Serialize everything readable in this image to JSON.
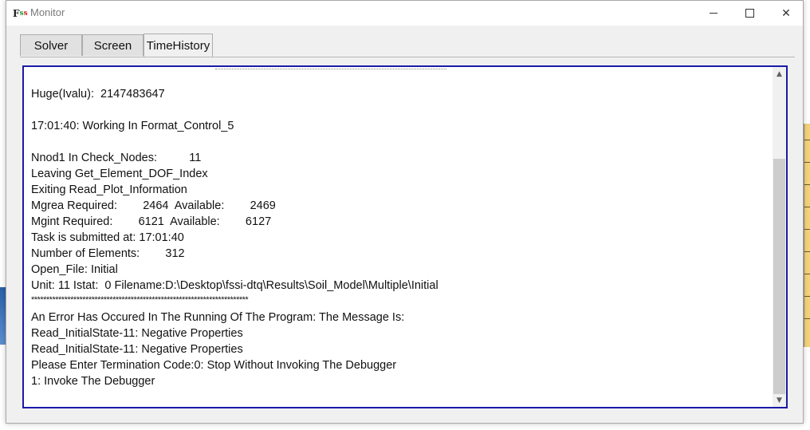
{
  "window": {
    "title": "Monitor",
    "icon": "fssi-app-icon",
    "controls": [
      "minimize-icon",
      "maximize-icon",
      "close-icon"
    ]
  },
  "tabs": [
    {
      "label": "Solver"
    },
    {
      "label": "Screen"
    },
    {
      "label": "TimeHistory"
    }
  ],
  "active_tab": "TimeHistory",
  "log": {
    "lines": [
      "Huge(Ivalu):  2147483647",
      "",
      "17:01:40: Working In Format_Control_5",
      "",
      "Nnod1 In Check_Nodes:          11",
      "Leaving Get_Element_DOF_Index",
      "Exiting Read_Plot_Information",
      "Mgrea Required:        2464  Available:        2469",
      "Mgint Required:        6121  Available:        6127",
      "Task is submitted at: 17:01:40",
      "Number of Elements:        312",
      "Open_File: Initial",
      "Unit: 11 Istat:  0 Filename:D:\\Desktop\\fssi-dtq\\Results\\Soil_Model\\Multiple\\Initial",
      "************************************************************************",
      "An Error Has Occured In The Running Of The Program: The Message Is:",
      "Read_InitialState-11: Negative Properties",
      "Read_InitialState-11: Negative Properties",
      "Please Enter Termination Code:0: Stop Without Invoking The Debugger",
      "1: Invoke The Debugger"
    ]
  },
  "colors": {
    "panel_border": "#1a1aa8",
    "window_bg": "#f0f0f0"
  }
}
